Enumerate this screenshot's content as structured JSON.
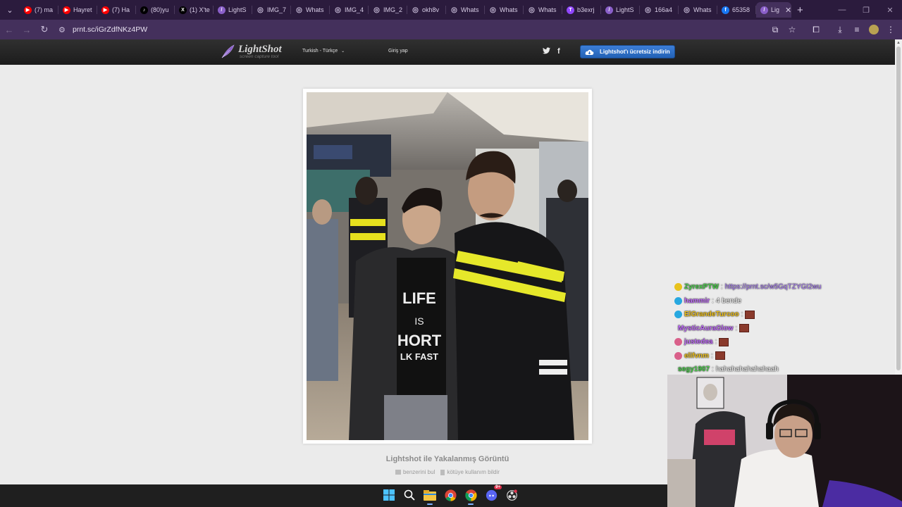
{
  "browser": {
    "tabs": [
      {
        "label": "(7) ma",
        "icon": "youtube-icon"
      },
      {
        "label": "Hayret",
        "icon": "youtube-icon"
      },
      {
        "label": "(7) Ha",
        "icon": "youtube-icon"
      },
      {
        "label": "(80)yu",
        "icon": "tiktok-icon"
      },
      {
        "label": "(1) X'te",
        "icon": "x-icon"
      },
      {
        "label": "LightS",
        "icon": "lightshot-icon"
      },
      {
        "label": "IMG_7",
        "icon": "globe-icon"
      },
      {
        "label": "Whats",
        "icon": "globe-icon"
      },
      {
        "label": "IMG_4",
        "icon": "globe-icon"
      },
      {
        "label": "IMG_2",
        "icon": "globe-icon"
      },
      {
        "label": "okh8v",
        "icon": "globe-icon"
      },
      {
        "label": "Whats",
        "icon": "globe-icon"
      },
      {
        "label": "Whats",
        "icon": "globe-icon"
      },
      {
        "label": "Whats",
        "icon": "globe-icon"
      },
      {
        "label": "b3exrj",
        "icon": "twitch-icon"
      },
      {
        "label": "LightS",
        "icon": "lightshot-icon"
      },
      {
        "label": "166a4",
        "icon": "globe-icon"
      },
      {
        "label": "Whats",
        "icon": "globe-icon"
      },
      {
        "label": "65358",
        "icon": "facebook-icon"
      },
      {
        "label": "Lig",
        "icon": "lightshot-icon",
        "active": true
      }
    ],
    "url": "prnt.sc/iGrZdfNKz4PW"
  },
  "lightshot": {
    "logo_name": "LightShot",
    "logo_sub": "screen capture tool",
    "language": "Turkish - Türkçe",
    "login": "Giriş yap",
    "download": "Lightshot'ı ücretsiz indirin",
    "caption": "Lightshot ile Yakalanmış Görüntü",
    "find_similar": "benzerini bul",
    "report_abuse": "kötüye kullanım bildir"
  },
  "chat": {
    "messages": [
      {
        "user": "ZyrexPTW",
        "sep": " : ",
        "text": "https://prnt.sc/w5GqTZYGI2wu",
        "user_color": "#4fd14f",
        "text_color": "#b083ff",
        "badge_color": "#e8c21c"
      },
      {
        "user": "hammir",
        "sep": " : ",
        "text": "4 bende",
        "user_color": "#c46cff",
        "text_color": "#ffffff",
        "badge_color": "#27a8e0"
      },
      {
        "user": "ElGrandeTurcoo",
        "sep": " : ",
        "text": "",
        "user_color": "#f0c21b",
        "text_color": "#ffffff",
        "badge_color": "#27a8e0",
        "emote": true
      },
      {
        "user": "MysticAuraGlow",
        "sep": " : ",
        "text": "",
        "user_color": "#c46cff",
        "text_color": "#ffffff",
        "badge_color": "",
        "emote": true
      },
      {
        "user": "justedea",
        "sep": " : ",
        "text": "",
        "user_color": "#c46cff",
        "text_color": "#ffffff",
        "badge_color": "#d9608a",
        "emote": true
      },
      {
        "user": "elifvnm",
        "sep": " : ",
        "text": "",
        "user_color": "#f0c21b",
        "text_color": "#ffffff",
        "badge_color": "#d9608a",
        "emote": true
      },
      {
        "user": "segy1907",
        "sep": " : ",
        "text": "hahahahahahahaah",
        "user_color": "#4fd14f",
        "text_color": "#ffffff",
        "badge_color": ""
      }
    ]
  },
  "taskbar": {
    "icons": [
      "windows-start-icon",
      "search-icon",
      "file-explorer-icon",
      "chrome-icon",
      "chrome-icon",
      "discord-icon",
      "obs-icon"
    ],
    "discord_badge": "9+"
  },
  "colors": {
    "tabstrip": "#2b1b3d",
    "toolbar": "#44305c",
    "download_button": "#2b6bc4",
    "page_bg": "#ebebeb"
  }
}
